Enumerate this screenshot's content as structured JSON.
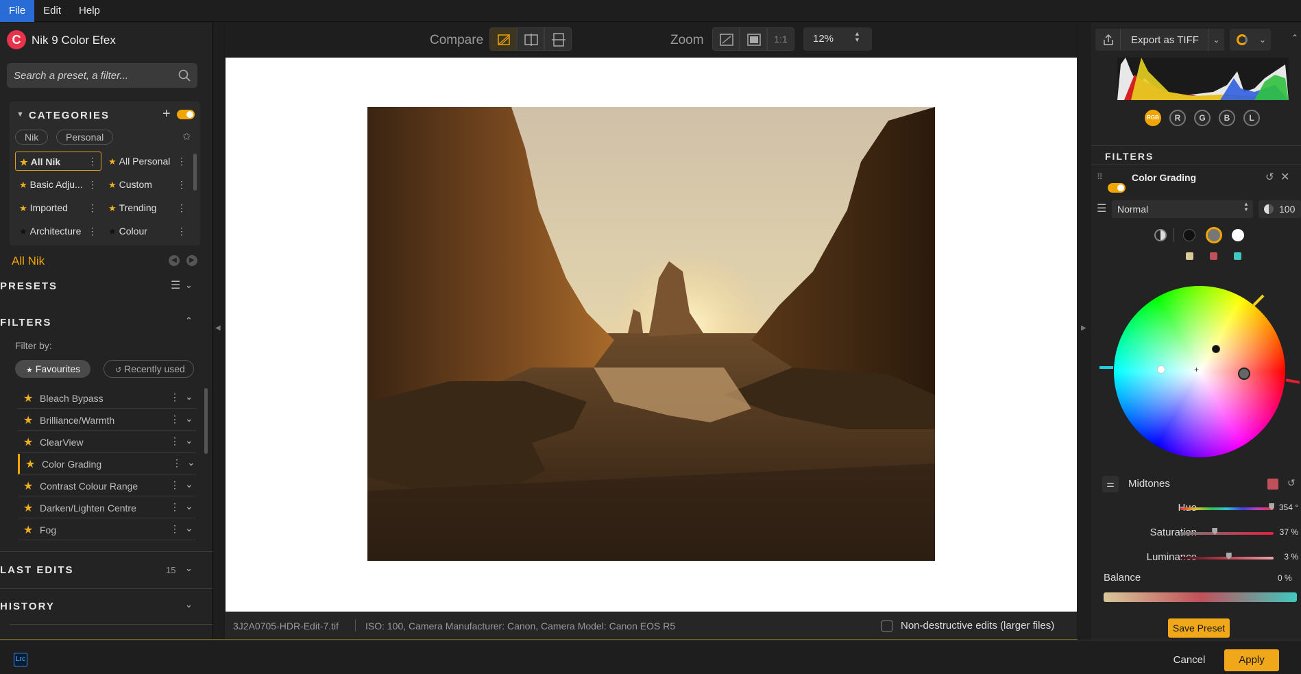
{
  "menu": [
    "File",
    "Edit",
    "Help"
  ],
  "app": {
    "logo_letter": "C",
    "name": "Nik 9 Color Efex"
  },
  "search": {
    "placeholder": "Search a preset, a filter..."
  },
  "categories": {
    "header": "CATEGORIES",
    "pills": [
      "Nik",
      "Personal"
    ],
    "tiles": [
      {
        "label": "All Nik",
        "selected": true
      },
      {
        "label": "All Personal"
      },
      {
        "label": "Basic Adju..."
      },
      {
        "label": "Custom"
      },
      {
        "label": "Imported"
      },
      {
        "label": "Trending"
      },
      {
        "label": "Architecture"
      },
      {
        "label": "Colour"
      }
    ],
    "current": "All Nik"
  },
  "presets": {
    "header": "PRESETS"
  },
  "filters_left": {
    "header": "FILTERS",
    "filter_by": "Filter by:",
    "favourites": "Favourites",
    "recently_used": "Recently used",
    "items": [
      "Bleach Bypass",
      "Brilliance/Warmth",
      "ClearView",
      "Color Grading",
      "Contrast Colour Range",
      "Darken/Lighten Centre",
      "Fog"
    ],
    "active": "Color Grading"
  },
  "last_edits": {
    "header": "LAST EDITS",
    "count": "15"
  },
  "history": {
    "header": "HISTORY"
  },
  "toolbar": {
    "compare": "Compare",
    "zoom": "Zoom",
    "one_to_one": "1:1",
    "zoom_value": "12%"
  },
  "status": {
    "filename": "3J2A0705-HDR-Edit-7.tif",
    "meta": "ISO: 100, Camera Manufacturer: Canon, Camera Model: Canon EOS R5",
    "nondestructive": "Non-destructive edits (larger files)"
  },
  "footer": {
    "lrc": "Lrc",
    "cancel": "Cancel",
    "apply": "Apply"
  },
  "right": {
    "export_label": "Export as TIFF",
    "channels": [
      "RGB",
      "R",
      "G",
      "B",
      "L"
    ],
    "filters_header": "FILTERS",
    "filter_name": "Color Grading",
    "blend_mode": "Normal",
    "opacity": "100",
    "tone": "Midtones",
    "sliders": [
      {
        "label": "Hue",
        "value": "354 °",
        "pos": 0.98
      },
      {
        "label": "Saturation",
        "value": "37 %",
        "pos": 0.37
      },
      {
        "label": "Luminance",
        "value": "3 %",
        "pos": 0.52
      }
    ],
    "balance": {
      "label": "Balance",
      "value": "0 %"
    },
    "save_preset": "Save Preset"
  }
}
